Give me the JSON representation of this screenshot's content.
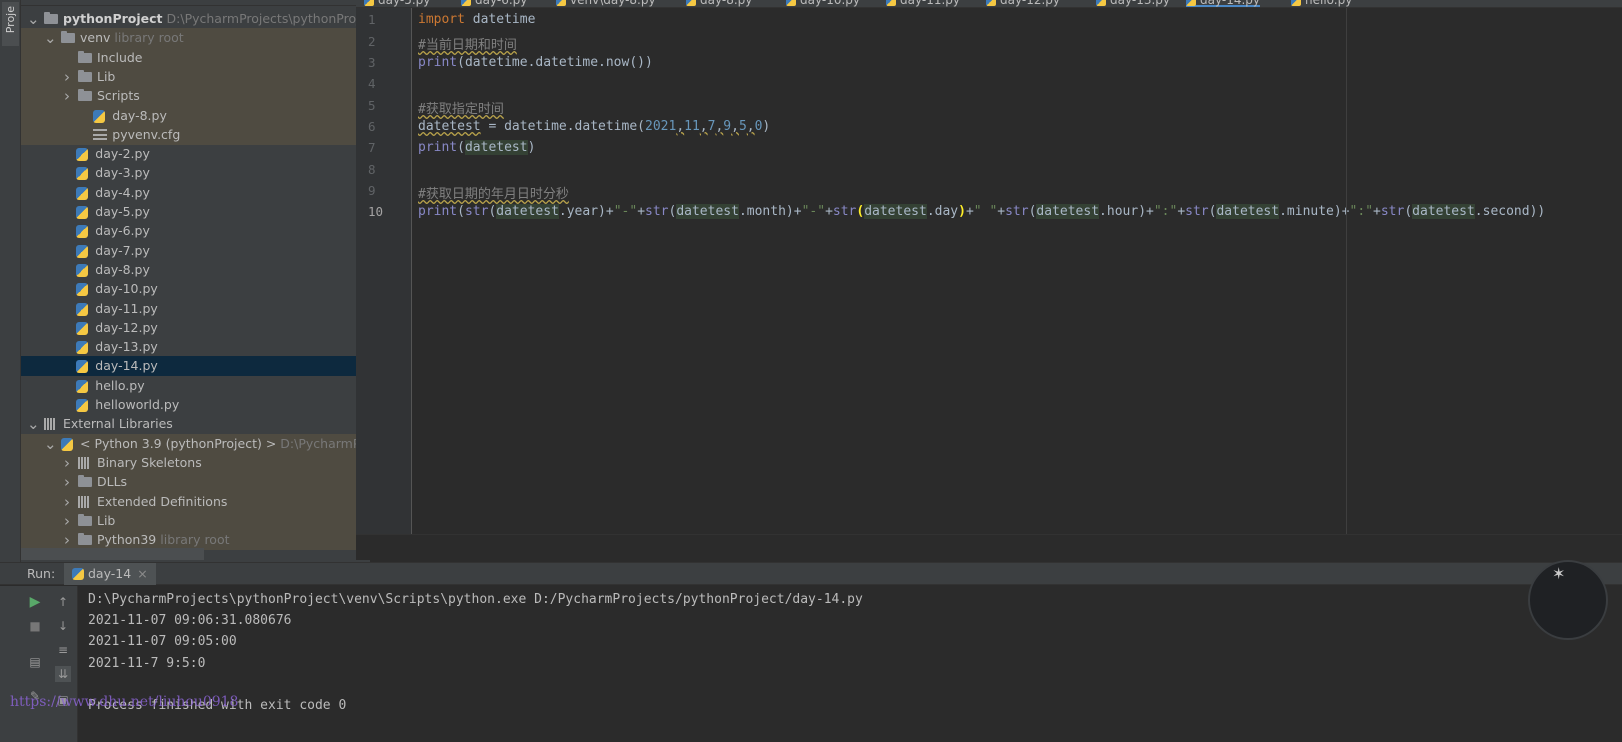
{
  "toolstrip": {
    "project_tab": "Proje"
  },
  "project_tree": {
    "root": {
      "name": "pythonProject",
      "path": "D:\\PycharmProjects\\pythonProject"
    },
    "venv": {
      "name": "venv",
      "note": "library root"
    },
    "venv_children": [
      "Include",
      "Lib",
      "Scripts",
      "day-8.py",
      "pyvenv.cfg"
    ],
    "files": [
      "day-2.py",
      "day-3.py",
      "day-4.py",
      "day-5.py",
      "day-6.py",
      "day-7.py",
      "day-8.py",
      "day-10.py",
      "day-11.py",
      "day-12.py",
      "day-13.py",
      "day-14.py",
      "hello.py",
      "helloworld.py"
    ],
    "selected": "day-14.py",
    "external": {
      "name": "External Libraries"
    },
    "python_sdk": {
      "name": "< Python 3.9 (pythonProject) >",
      "path": "D:\\PycharmProjec"
    },
    "sdk_children": [
      "Binary Skeletons",
      "DLLs",
      "Extended Definitions",
      "Lib",
      "Python39"
    ],
    "python39_note": "library root"
  },
  "editor": {
    "tabs": [
      "day-5.py",
      "day-6.py",
      "venv\\day-8.py",
      "day-8.py",
      "day-10.py",
      "day-11.py",
      "day-12.py",
      "day-13.py",
      "day-14.py",
      "hello.py"
    ],
    "active_tab": "day-14.py",
    "line_numbers": [
      "1",
      "2",
      "3",
      "4",
      "5",
      "6",
      "7",
      "8",
      "9",
      "10"
    ],
    "code": {
      "l1_kw": "import",
      "l1_rest": " datetime",
      "l2": "#当前日期和时间",
      "l3_fn": "print",
      "l3_rest": "(datetime.datetime.now())",
      "l5": "#获取指定时间",
      "l6_var": "datetest",
      "l6_a": " = datetime.datetime(",
      "l6_n1": "2021",
      "l6_n2": "11",
      "l6_n3": "7",
      "l6_n4": "9",
      "l6_n5": "5",
      "l6_n6": "0",
      "l6_close": ")",
      "l6_comma": ",",
      "l7_fn": "print",
      "l7_open": "(",
      "l7_var": "datetest",
      "l7_close": ")",
      "l9": "#获取日期的年月日时分秒",
      "l10": {
        "print": "print",
        "str": "str",
        "var": "datetest",
        "year": ".year",
        "month": ".month",
        "day": ".day",
        "hour": ".hour",
        "minute": ".minute",
        "second": ".second",
        "dash": "\"-\"",
        "space": "\" \"",
        "colon": "\":\"",
        "plus": "+",
        "open": "(",
        "close": ")"
      }
    }
  },
  "run": {
    "label": "Run:",
    "tab": "day-14",
    "output": [
      "D:\\PycharmProjects\\pythonProject\\venv\\Scripts\\python.exe D:/PycharmProjects/pythonProject/day-14.py",
      "2021-11-07 09:06:31.080676",
      "2021-11-07 09:05:00",
      "2021-11-7 9:5:0",
      "",
      "Process finished with exit code 0"
    ]
  },
  "watermark": "https://www.dhu.net/liuhou0918"
}
